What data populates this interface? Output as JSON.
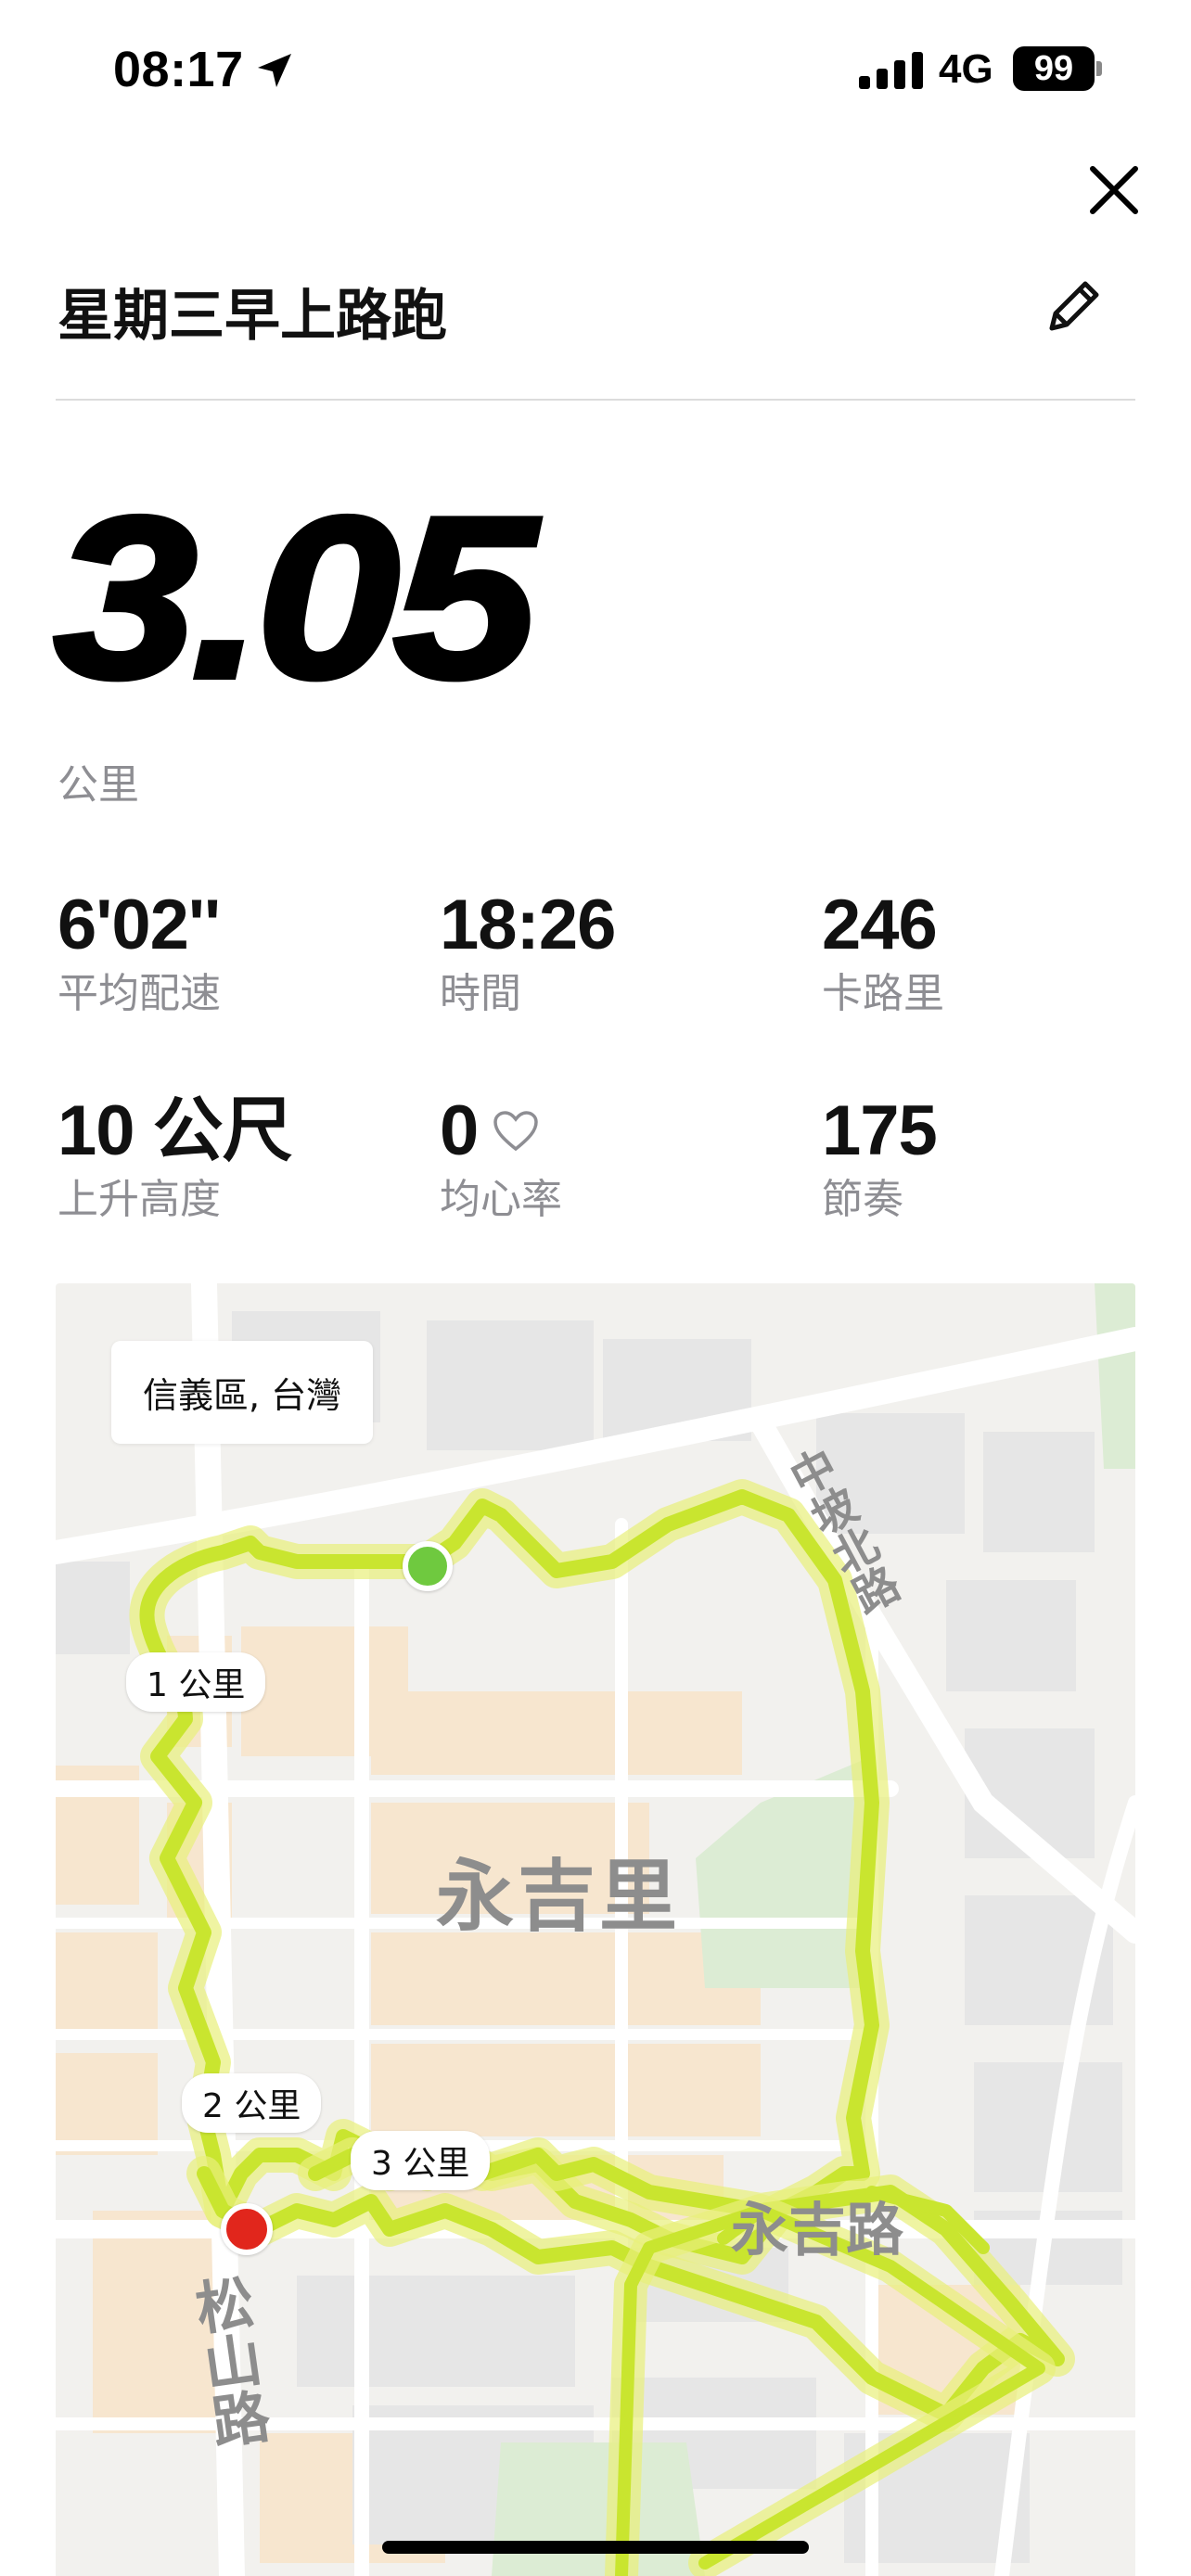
{
  "status_bar": {
    "time": "08:17",
    "network": "4G",
    "battery": "99"
  },
  "header": {
    "title": "星期三早上路跑"
  },
  "summary": {
    "distance": "3.05",
    "distance_unit": "公里"
  },
  "stats": [
    {
      "value": "6'02''",
      "label": "平均配速"
    },
    {
      "value": "18:26",
      "label": "時間"
    },
    {
      "value": "246",
      "label": "卡路里"
    },
    {
      "value": "10 公尺",
      "label": "上升高度"
    },
    {
      "value": "0",
      "label": "均心率"
    },
    {
      "value": "175",
      "label": "節奏"
    }
  ],
  "map": {
    "location": "信義區, 台灣",
    "district": "永吉里",
    "road_main": "永吉路",
    "road_north": "中坡北路",
    "road_west": "松山路",
    "km_markers": [
      "1 公里",
      "2 公里",
      "3 公里"
    ],
    "route_color": "#c9e52f",
    "start_color": "#6fc93f",
    "end_color": "#e1261c"
  },
  "icons": {
    "location": "location-arrow-icon",
    "close": "close-icon",
    "edit": "pencil-icon",
    "heart": "heart-outline-icon"
  }
}
